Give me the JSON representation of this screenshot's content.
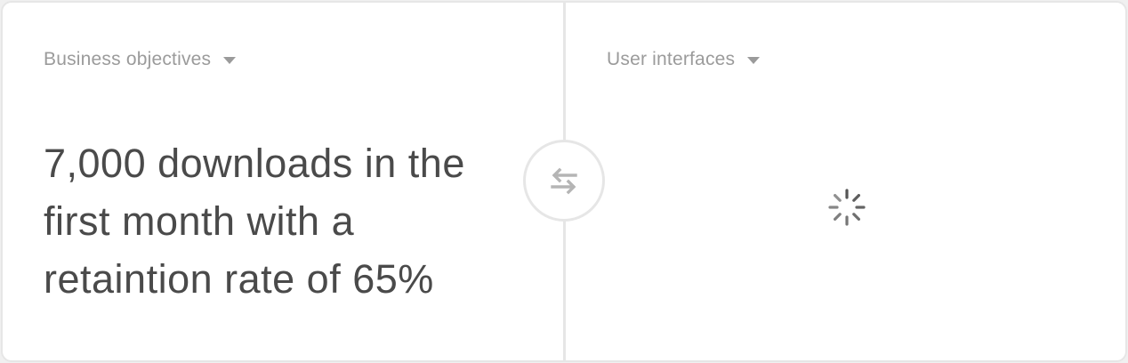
{
  "left_panel": {
    "dropdown_label": "Business objectives",
    "objective_text": "7,000 downloads in the first month with a retaintion rate of 65%"
  },
  "right_panel": {
    "dropdown_label": "User interfaces",
    "state": "loading"
  },
  "swap_button": {
    "icon": "swap-arrows-icon"
  },
  "colors": {
    "background": "#ffffff",
    "border": "#e6e6e6",
    "label": "#9b9b9b",
    "body_text": "#4a4a4a",
    "icon": "#b5b5b5",
    "spinner": "#555555"
  }
}
